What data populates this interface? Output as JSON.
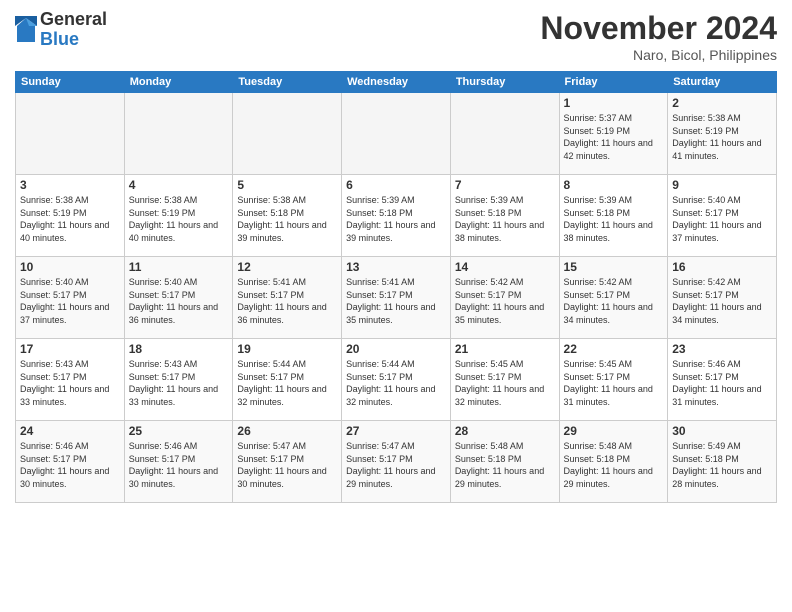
{
  "header": {
    "logo_general": "General",
    "logo_blue": "Blue",
    "month_title": "November 2024",
    "location": "Naro, Bicol, Philippines"
  },
  "days_of_week": [
    "Sunday",
    "Monday",
    "Tuesday",
    "Wednesday",
    "Thursday",
    "Friday",
    "Saturday"
  ],
  "weeks": [
    [
      {
        "day": "",
        "info": ""
      },
      {
        "day": "",
        "info": ""
      },
      {
        "day": "",
        "info": ""
      },
      {
        "day": "",
        "info": ""
      },
      {
        "day": "",
        "info": ""
      },
      {
        "day": "1",
        "info": "Sunrise: 5:37 AM\nSunset: 5:19 PM\nDaylight: 11 hours and 42 minutes."
      },
      {
        "day": "2",
        "info": "Sunrise: 5:38 AM\nSunset: 5:19 PM\nDaylight: 11 hours and 41 minutes."
      }
    ],
    [
      {
        "day": "3",
        "info": "Sunrise: 5:38 AM\nSunset: 5:19 PM\nDaylight: 11 hours and 40 minutes."
      },
      {
        "day": "4",
        "info": "Sunrise: 5:38 AM\nSunset: 5:19 PM\nDaylight: 11 hours and 40 minutes."
      },
      {
        "day": "5",
        "info": "Sunrise: 5:38 AM\nSunset: 5:18 PM\nDaylight: 11 hours and 39 minutes."
      },
      {
        "day": "6",
        "info": "Sunrise: 5:39 AM\nSunset: 5:18 PM\nDaylight: 11 hours and 39 minutes."
      },
      {
        "day": "7",
        "info": "Sunrise: 5:39 AM\nSunset: 5:18 PM\nDaylight: 11 hours and 38 minutes."
      },
      {
        "day": "8",
        "info": "Sunrise: 5:39 AM\nSunset: 5:18 PM\nDaylight: 11 hours and 38 minutes."
      },
      {
        "day": "9",
        "info": "Sunrise: 5:40 AM\nSunset: 5:17 PM\nDaylight: 11 hours and 37 minutes."
      }
    ],
    [
      {
        "day": "10",
        "info": "Sunrise: 5:40 AM\nSunset: 5:17 PM\nDaylight: 11 hours and 37 minutes."
      },
      {
        "day": "11",
        "info": "Sunrise: 5:40 AM\nSunset: 5:17 PM\nDaylight: 11 hours and 36 minutes."
      },
      {
        "day": "12",
        "info": "Sunrise: 5:41 AM\nSunset: 5:17 PM\nDaylight: 11 hours and 36 minutes."
      },
      {
        "day": "13",
        "info": "Sunrise: 5:41 AM\nSunset: 5:17 PM\nDaylight: 11 hours and 35 minutes."
      },
      {
        "day": "14",
        "info": "Sunrise: 5:42 AM\nSunset: 5:17 PM\nDaylight: 11 hours and 35 minutes."
      },
      {
        "day": "15",
        "info": "Sunrise: 5:42 AM\nSunset: 5:17 PM\nDaylight: 11 hours and 34 minutes."
      },
      {
        "day": "16",
        "info": "Sunrise: 5:42 AM\nSunset: 5:17 PM\nDaylight: 11 hours and 34 minutes."
      }
    ],
    [
      {
        "day": "17",
        "info": "Sunrise: 5:43 AM\nSunset: 5:17 PM\nDaylight: 11 hours and 33 minutes."
      },
      {
        "day": "18",
        "info": "Sunrise: 5:43 AM\nSunset: 5:17 PM\nDaylight: 11 hours and 33 minutes."
      },
      {
        "day": "19",
        "info": "Sunrise: 5:44 AM\nSunset: 5:17 PM\nDaylight: 11 hours and 32 minutes."
      },
      {
        "day": "20",
        "info": "Sunrise: 5:44 AM\nSunset: 5:17 PM\nDaylight: 11 hours and 32 minutes."
      },
      {
        "day": "21",
        "info": "Sunrise: 5:45 AM\nSunset: 5:17 PM\nDaylight: 11 hours and 32 minutes."
      },
      {
        "day": "22",
        "info": "Sunrise: 5:45 AM\nSunset: 5:17 PM\nDaylight: 11 hours and 31 minutes."
      },
      {
        "day": "23",
        "info": "Sunrise: 5:46 AM\nSunset: 5:17 PM\nDaylight: 11 hours and 31 minutes."
      }
    ],
    [
      {
        "day": "24",
        "info": "Sunrise: 5:46 AM\nSunset: 5:17 PM\nDaylight: 11 hours and 30 minutes."
      },
      {
        "day": "25",
        "info": "Sunrise: 5:46 AM\nSunset: 5:17 PM\nDaylight: 11 hours and 30 minutes."
      },
      {
        "day": "26",
        "info": "Sunrise: 5:47 AM\nSunset: 5:17 PM\nDaylight: 11 hours and 30 minutes."
      },
      {
        "day": "27",
        "info": "Sunrise: 5:47 AM\nSunset: 5:17 PM\nDaylight: 11 hours and 29 minutes."
      },
      {
        "day": "28",
        "info": "Sunrise: 5:48 AM\nSunset: 5:18 PM\nDaylight: 11 hours and 29 minutes."
      },
      {
        "day": "29",
        "info": "Sunrise: 5:48 AM\nSunset: 5:18 PM\nDaylight: 11 hours and 29 minutes."
      },
      {
        "day": "30",
        "info": "Sunrise: 5:49 AM\nSunset: 5:18 PM\nDaylight: 11 hours and 28 minutes."
      }
    ]
  ]
}
